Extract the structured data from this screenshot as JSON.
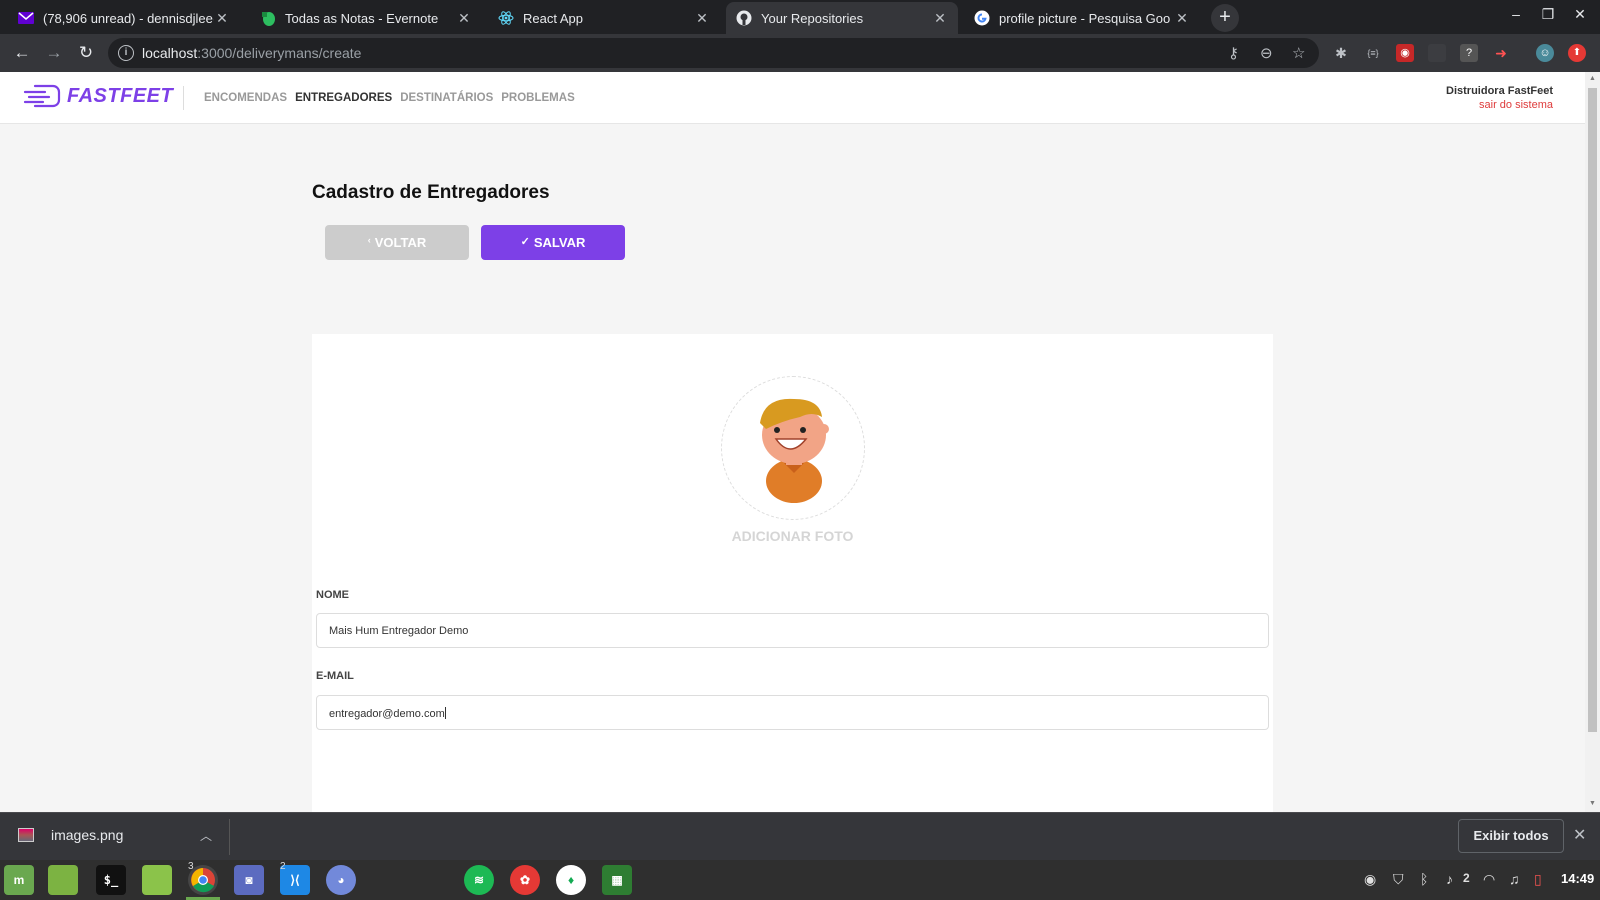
{
  "browser": {
    "tabs": [
      {
        "title": "(78,906 unread) - dennisdjlee@",
        "icon": "mail-icon"
      },
      {
        "title": "Todas as Notas - Evernote",
        "icon": "evernote-icon"
      },
      {
        "title": "React App",
        "icon": "react-icon"
      },
      {
        "title": "Your Repositories",
        "icon": "github-icon"
      },
      {
        "title": "profile picture - Pesquisa Goo",
        "icon": "google-icon"
      }
    ],
    "url_host": "localhost",
    "url_path": ":3000/deliverymans/create"
  },
  "app": {
    "logo_text": "FASTFEET",
    "nav": [
      "ENCOMENDAS",
      "ENTREGADORES",
      "DESTINATÁRIOS",
      "PROBLEMAS"
    ],
    "active_nav": "ENTREGADORES",
    "user_name": "Distruidora FastFeet",
    "logout_label": "sair do sistema",
    "brand_color": "#7d40e7"
  },
  "form": {
    "title": "Cadastro de Entregadores",
    "back_label": "VOLTAR",
    "save_label": "SALVAR",
    "add_photo_label": "ADICIONAR FOTO",
    "name_label": "NOME",
    "name_value": "Mais Hum Entregador Demo",
    "email_label": "E-MAIL",
    "email_value": "entregador@demo.com"
  },
  "downloads": {
    "file_name": "images.png",
    "show_all_label": "Exibir todos"
  },
  "taskbar": {
    "chrome_badge": "3",
    "vscode_badge": "2",
    "notification_count": "2",
    "clock": "14:49"
  }
}
